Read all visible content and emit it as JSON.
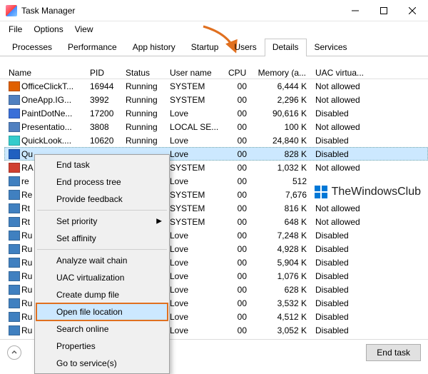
{
  "window": {
    "title": "Task Manager"
  },
  "menu": {
    "file": "File",
    "options": "Options",
    "view": "View"
  },
  "tabs": {
    "processes": "Processes",
    "performance": "Performance",
    "app_history": "App history",
    "startup": "Startup",
    "users": "Users",
    "details": "Details",
    "services": "Services"
  },
  "columns": {
    "name": "Name",
    "pid": "PID",
    "status": "Status",
    "user": "User name",
    "cpu": "CPU",
    "mem": "Memory (a...",
    "uac": "UAC virtua..."
  },
  "rows": [
    {
      "name": "OfficeClickT...",
      "pid": "16944",
      "status": "Running",
      "user": "SYSTEM",
      "cpu": "00",
      "mem": "6,444 K",
      "uac": "Not allowed",
      "iconColor": "#e06000"
    },
    {
      "name": "OneApp.IG...",
      "pid": "3992",
      "status": "Running",
      "user": "SYSTEM",
      "cpu": "00",
      "mem": "2,296 K",
      "uac": "Not allowed",
      "iconColor": "#5080c0"
    },
    {
      "name": "PaintDotNe...",
      "pid": "17200",
      "status": "Running",
      "user": "Love",
      "cpu": "00",
      "mem": "90,616 K",
      "uac": "Disabled",
      "iconColor": "#3a6fd8"
    },
    {
      "name": "Presentatio...",
      "pid": "3808",
      "status": "Running",
      "user": "LOCAL SE...",
      "cpu": "00",
      "mem": "100 K",
      "uac": "Not allowed",
      "iconColor": "#5080c0"
    },
    {
      "name": "QuickLook....",
      "pid": "10620",
      "status": "Running",
      "user": "Love",
      "cpu": "00",
      "mem": "24,840 K",
      "uac": "Disabled",
      "iconColor": "#3cc"
    },
    {
      "name": "Qu",
      "pid": "",
      "status": "",
      "user": "Love",
      "cpu": "00",
      "mem": "828 K",
      "uac": "Disabled",
      "iconColor": "#2060c0",
      "selected": true
    },
    {
      "name": "RA",
      "pid": "",
      "status": "",
      "user": "SYSTEM",
      "cpu": "00",
      "mem": "1,032 K",
      "uac": "Not allowed",
      "iconColor": "#d04030"
    },
    {
      "name": "re",
      "pid": "",
      "status": "",
      "user": "Love",
      "cpu": "00",
      "mem": "512",
      "uac": "",
      "iconColor": "#4080c0"
    },
    {
      "name": "Re",
      "pid": "",
      "status": "",
      "user": "SYSTEM",
      "cpu": "00",
      "mem": "7,676",
      "uac": "",
      "iconColor": "#4080c0"
    },
    {
      "name": "Rt",
      "pid": "",
      "status": "",
      "user": "SYSTEM",
      "cpu": "00",
      "mem": "816 K",
      "uac": "Not allowed",
      "iconColor": "#4080c0"
    },
    {
      "name": "Rt",
      "pid": "",
      "status": "",
      "user": "SYSTEM",
      "cpu": "00",
      "mem": "648 K",
      "uac": "Not allowed",
      "iconColor": "#4080c0"
    },
    {
      "name": "Ru",
      "pid": "",
      "status": "",
      "user": "Love",
      "cpu": "00",
      "mem": "7,248 K",
      "uac": "Disabled",
      "iconColor": "#4080c0"
    },
    {
      "name": "Ru",
      "pid": "",
      "status": "",
      "user": "Love",
      "cpu": "00",
      "mem": "4,928 K",
      "uac": "Disabled",
      "iconColor": "#4080c0"
    },
    {
      "name": "Ru",
      "pid": "",
      "status": "",
      "user": "Love",
      "cpu": "00",
      "mem": "5,904 K",
      "uac": "Disabled",
      "iconColor": "#4080c0"
    },
    {
      "name": "Ru",
      "pid": "",
      "status": "",
      "user": "Love",
      "cpu": "00",
      "mem": "1,076 K",
      "uac": "Disabled",
      "iconColor": "#4080c0"
    },
    {
      "name": "Ru",
      "pid": "",
      "status": "",
      "user": "Love",
      "cpu": "00",
      "mem": "628 K",
      "uac": "Disabled",
      "iconColor": "#4080c0"
    },
    {
      "name": "Ru",
      "pid": "",
      "status": "",
      "user": "Love",
      "cpu": "00",
      "mem": "3,532 K",
      "uac": "Disabled",
      "iconColor": "#4080c0"
    },
    {
      "name": "Ru",
      "pid": "",
      "status": "",
      "user": "Love",
      "cpu": "00",
      "mem": "4,512 K",
      "uac": "Disabled",
      "iconColor": "#4080c0"
    },
    {
      "name": "Ru",
      "pid": "",
      "status": "",
      "user": "Love",
      "cpu": "00",
      "mem": "3,052 K",
      "uac": "Disabled",
      "iconColor": "#4080c0"
    }
  ],
  "context": {
    "end_task": "End task",
    "end_tree": "End process tree",
    "feedback": "Provide feedback",
    "priority": "Set priority",
    "affinity": "Set affinity",
    "analyze": "Analyze wait chain",
    "uac": "UAC virtualization",
    "dump": "Create dump file",
    "open_loc": "Open file location",
    "search": "Search online",
    "props": "Properties",
    "services": "Go to service(s)"
  },
  "footer": {
    "end_task": "End task"
  },
  "watermark": {
    "text": "TheWindowsClub"
  }
}
